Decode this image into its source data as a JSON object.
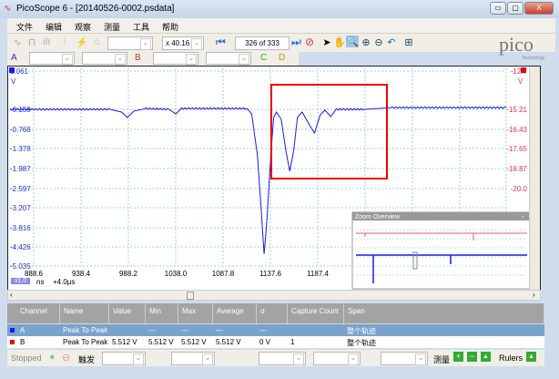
{
  "window": {
    "title": "PicoScope 6 - [20140526-0002.psdata]",
    "min": "▭",
    "max": "▢",
    "close": "X"
  },
  "menu": [
    "文件",
    "编辑",
    "观察",
    "测量",
    "工具",
    "帮助"
  ],
  "toolbar": {
    "zoom_factor": "x 40.16",
    "buffer": "326 of 333",
    "logo": "pico",
    "logo_sub": "Technology"
  },
  "channels": {
    "a": "A",
    "b": "B",
    "c": "C",
    "d": "D"
  },
  "axes": {
    "left_unit": "V",
    "right_unit": "V",
    "left_ticks": [
      "1.061",
      "-0.159",
      "-0.768",
      "-1.378",
      "-1.987",
      "-2.597",
      "-3.207",
      "-3.816",
      "-4.426",
      "-5.035"
    ],
    "right_ticks": [
      "-12.7",
      "-15.21",
      "-16.43",
      "-17.65",
      "-18.87",
      "-20.0"
    ],
    "x_ticks": [
      "888.6",
      "938.4",
      "988.2",
      "1038.0",
      "1087.8",
      "1137.6",
      "1187.4"
    ],
    "x_zoom": "x1.0",
    "x_unit": "ns",
    "x_offset": "+4.0µs"
  },
  "trace_a": {
    "color": "#1a1aee",
    "points": [
      [
        864,
        -0.135
      ],
      [
        969,
        -0.135
      ],
      [
        981,
        -0.22
      ],
      [
        987,
        -0.39
      ],
      [
        994,
        -0.19
      ],
      [
        1007,
        -0.11
      ],
      [
        1031,
        -0.135
      ],
      [
        1038,
        -0.28
      ],
      [
        1044,
        -0.11
      ],
      [
        1113,
        -0.11
      ],
      [
        1118,
        -0.28
      ],
      [
        1124,
        -1.59
      ],
      [
        1128,
        -3.3
      ],
      [
        1131,
        -4.66
      ],
      [
        1134,
        -3.58
      ],
      [
        1138,
        -1.59
      ],
      [
        1141,
        -0.39
      ],
      [
        1144,
        -0.22
      ],
      [
        1149,
        -0.45
      ],
      [
        1154,
        -1.45
      ],
      [
        1158,
        -2.07
      ],
      [
        1162,
        -1.45
      ],
      [
        1166,
        -0.39
      ],
      [
        1171,
        -0.22
      ],
      [
        1178,
        -0.59
      ],
      [
        1184,
        -0.88
      ],
      [
        1190,
        -0.31
      ],
      [
        1195,
        -0.16
      ],
      [
        1201,
        -0.36
      ],
      [
        1207,
        -0.135
      ],
      [
        1237,
        -0.135
      ],
      [
        1266,
        -0.08
      ],
      [
        1386,
        -0.08
      ]
    ]
  },
  "overview": {
    "title": "Zoom Overview",
    "close": "-"
  },
  "table": {
    "headers": [
      "Channel",
      "Name",
      "Value",
      "Min",
      "Max",
      "Average",
      "σ",
      "Capture Count",
      "Span"
    ],
    "rows": [
      [
        "A",
        "Peak To Peak",
        "",
        "---",
        "---",
        "---",
        "---",
        "",
        "整个轨迹"
      ],
      [
        "B",
        "Peak To Peak",
        "5.512 V",
        "5.512 V",
        "5.512 V",
        "5.512 V",
        "0 V",
        "1",
        "整个轨迹"
      ]
    ]
  },
  "status": {
    "state": "Stopped",
    "trigger": "触发",
    "measure": "测量",
    "rulers": "Rulers"
  }
}
